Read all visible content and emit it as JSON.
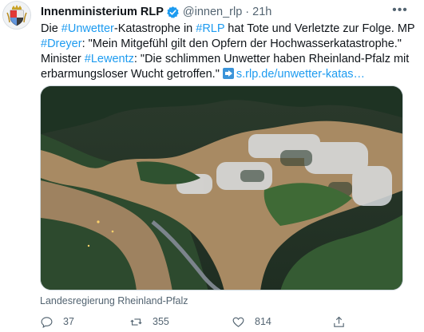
{
  "tweet": {
    "display_name": "Innenministerium RLP",
    "handle": "@innen_rlp",
    "separator": "·",
    "time": "21h",
    "more_label": "•••",
    "text": {
      "p1": "Die ",
      "tag1": "#Unwetter",
      "p2": "-Katastrophe in ",
      "tag2": "#RLP",
      "p3": " hat Tote und Verletzte zur Folge. MP ",
      "tag3": "#Dreyer",
      "p4": ": \"Mein Mitgefühl gilt den Opfern der Hochwasserkatastrophe.\" Minister ",
      "tag4": "#Lewentz",
      "p5": ": \"Die schlimmen Unwetter haben Rheinland-Pfalz mit erbarmungsloser Wucht getroffen.\" ",
      "link": "s.rlp.de/unwetter-katas…"
    },
    "media_caption": "Landesregierung Rheinland-Pfalz",
    "actions": {
      "replies": "37",
      "retweets": "355",
      "likes": "814"
    }
  },
  "colors": {
    "accent": "#1d9bf0",
    "muted": "#536471",
    "verified": "#1d9bf0"
  },
  "icons": [
    "coat-of-arms-avatar",
    "verified-badge-icon",
    "more-icon",
    "link-arrow-icon",
    "reply-icon",
    "retweet-icon",
    "like-icon",
    "share-icon"
  ]
}
